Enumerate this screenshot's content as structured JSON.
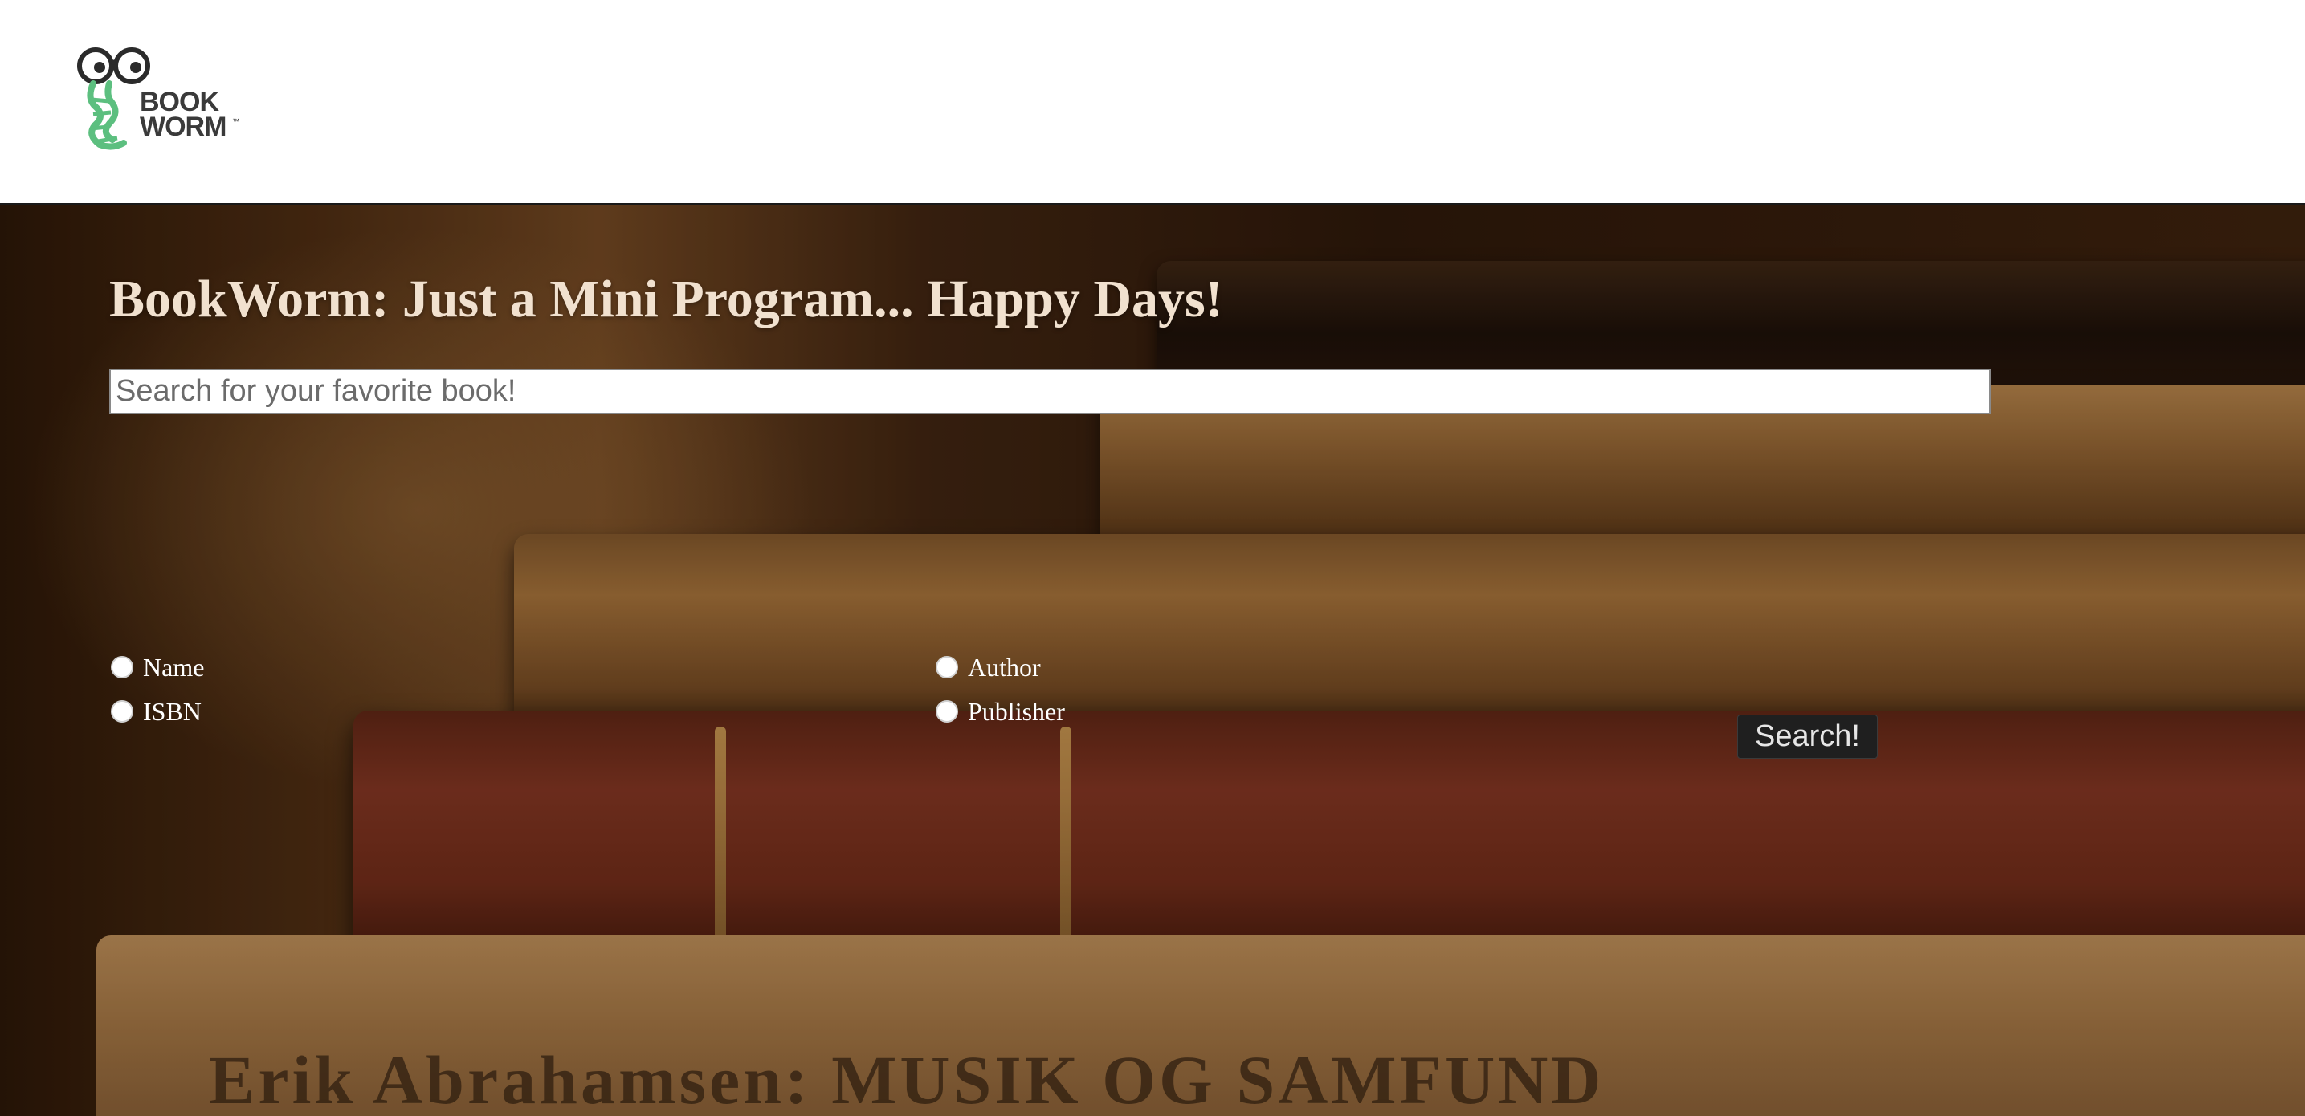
{
  "header": {
    "logo_line1": "BOOK",
    "logo_line2": "WORM",
    "logo_tm": "™",
    "logo_colors": {
      "worm": "#5cbf7f",
      "glasses": "#2b2b2b"
    }
  },
  "hero": {
    "title": "BookWorm: Just a Mini Program... Happy Days!",
    "spine_text": "Erik Abrahamsen: MUSIK OG SAMFUND",
    "search": {
      "placeholder": "Search for your favorite book!",
      "value": ""
    },
    "filters": [
      {
        "label": "Name",
        "selected": false
      },
      {
        "label": "ISBN",
        "selected": false
      },
      {
        "label": "Author",
        "selected": false
      },
      {
        "label": "Publisher",
        "selected": false
      }
    ],
    "search_button_label": "Search!"
  }
}
